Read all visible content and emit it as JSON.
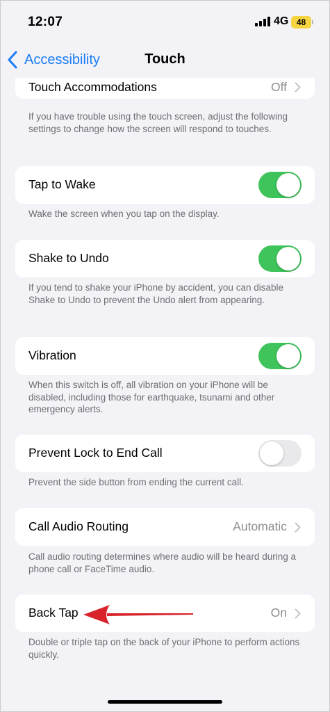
{
  "status_bar": {
    "time": "12:07",
    "network": "4G",
    "battery": "48",
    "battery_color": "#f5d341"
  },
  "nav": {
    "back_label": "Accessibility",
    "title": "Touch",
    "accent_color": "#1a7cf5"
  },
  "rows": {
    "touch_accommodations": {
      "label": "Touch Accommodations",
      "value": "Off",
      "footnote": "If you have trouble using the touch screen, adjust the following settings to change how the screen will respond to touches."
    },
    "tap_to_wake": {
      "label": "Tap to Wake",
      "state": "on",
      "footnote": "Wake the screen when you tap on the display."
    },
    "shake_to_undo": {
      "label": "Shake to Undo",
      "state": "on",
      "footnote": "If you tend to shake your iPhone by accident, you can disable Shake to Undo to prevent the Undo alert from appearing."
    },
    "vibration": {
      "label": "Vibration",
      "state": "on",
      "footnote": "When this switch is off, all vibration on your iPhone will be disabled, including those for earthquake, tsunami and other emergency alerts."
    },
    "prevent_lock": {
      "label": "Prevent Lock to End Call",
      "state": "off",
      "footnote": "Prevent the side button from ending the current call."
    },
    "call_audio_routing": {
      "label": "Call Audio Routing",
      "value": "Automatic",
      "footnote": "Call audio routing determines where audio will be heard during a phone call or FaceTime audio."
    },
    "back_tap": {
      "label": "Back Tap",
      "value": "On",
      "footnote": "Double or triple tap on the back of your iPhone to perform actions quickly."
    }
  },
  "colors": {
    "toggle_on": "#3ec45a",
    "annotation_arrow": "#d8232a"
  }
}
